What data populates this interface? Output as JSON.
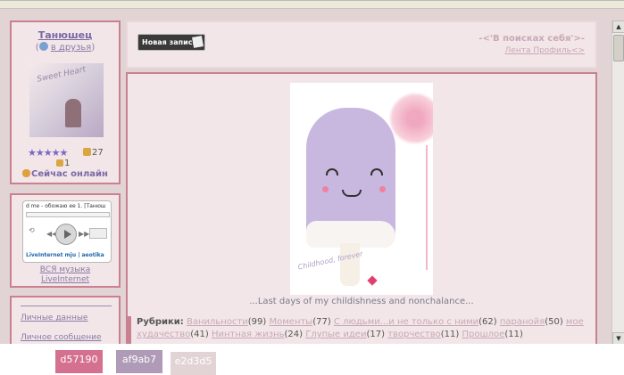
{
  "profile": {
    "name": "Танюшец",
    "friend_link": "в друзья",
    "avatar_text": "Sweet Heart",
    "stars": "★★★★★",
    "rating": "27",
    "votes": "1",
    "online": "Сейчас онлайн"
  },
  "player": {
    "track": "d me - обожаю ее  1. [Танюш",
    "brand": "LiveInternet  mju | aeotika",
    "music_link": "ВСЯ музыка",
    "li_link": "LiveInternet"
  },
  "links": {
    "personal_data": "Личные данные",
    "personal_message": "Личное сообщение"
  },
  "header": {
    "new_post": "Новая запись",
    "blog_title": "-<'В поисках себя'>-",
    "feed_link": "Лента Профиль<>"
  },
  "post": {
    "image_text": "Childhood, forever",
    "caption": "...Last days of my childishness and nonchalance...",
    "rubrics_label": "Рубрики:",
    "rubrics": [
      {
        "name": "Ванильности",
        "count": "(99)"
      },
      {
        "name": "Моменты",
        "count": "(77)"
      },
      {
        "name": "С людьми...и не только с ними",
        "count": "(62)"
      },
      {
        "name": "паранойя",
        "count": "(50)"
      },
      {
        "name": "мое худачество",
        "count": "(41)"
      },
      {
        "name": "Нинтная жизнь",
        "count": "(24)"
      },
      {
        "name": "Глупые идеи",
        "count": "(17)"
      },
      {
        "name": "творчество",
        "count": "(11)"
      },
      {
        "name": "Прошлое",
        "count": "(11)"
      }
    ]
  },
  "palette": [
    "d57190",
    "af9ab7",
    "e2d3d5"
  ]
}
